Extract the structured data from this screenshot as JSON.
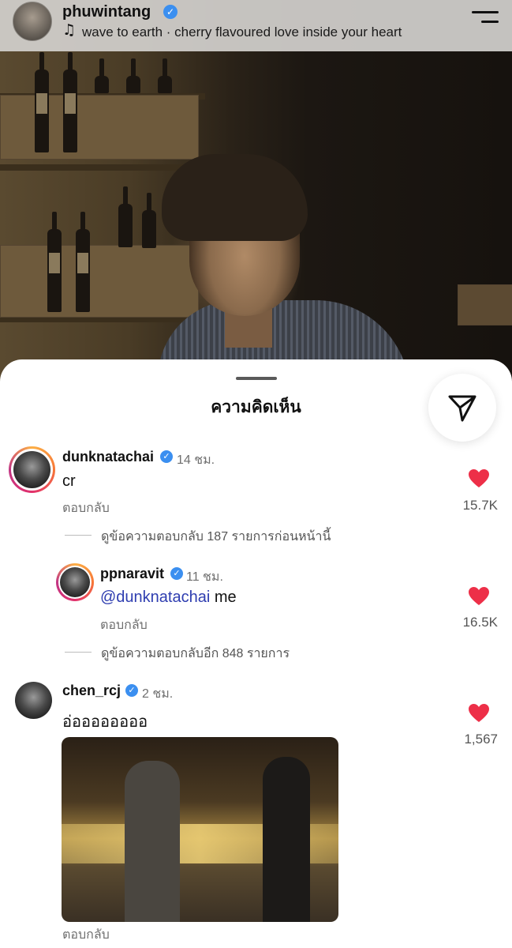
{
  "header": {
    "username": "phuwintang",
    "verified": true,
    "song": "wave to earth · cherry flavoured love inside your heart",
    "music_icon": "music-note-icon",
    "menu_icon": "menu-icon"
  },
  "sheet": {
    "title": "ความคิดเห็น",
    "send_icon": "send-icon"
  },
  "colors": {
    "heart": "#ed2f48",
    "verified": "#3b8ff0",
    "mention": "#2e3db0"
  },
  "comments": [
    {
      "username": "dunknatachai",
      "verified": true,
      "time": "14 ชม.",
      "text": "cr",
      "reply_label": "ตอบกลับ",
      "likes": "15.7K",
      "view_replies": "ดูข้อความตอบกลับ 187 รายการก่อนหน้านี้",
      "replies": [
        {
          "username": "ppnaravit",
          "verified": true,
          "time": "11 ชม.",
          "mention": "@dunknatachai",
          "text": " me",
          "reply_label": "ตอบกลับ",
          "likes": "16.5K"
        }
      ],
      "view_more_replies": "ดูข้อความตอบกลับอีก 848 รายการ"
    },
    {
      "username": "chen_rcj",
      "verified": true,
      "time": "2 ชม.",
      "text": "อ่ออออออออ",
      "likes": "1,567",
      "reply_label": "ตอบกลับ"
    }
  ]
}
